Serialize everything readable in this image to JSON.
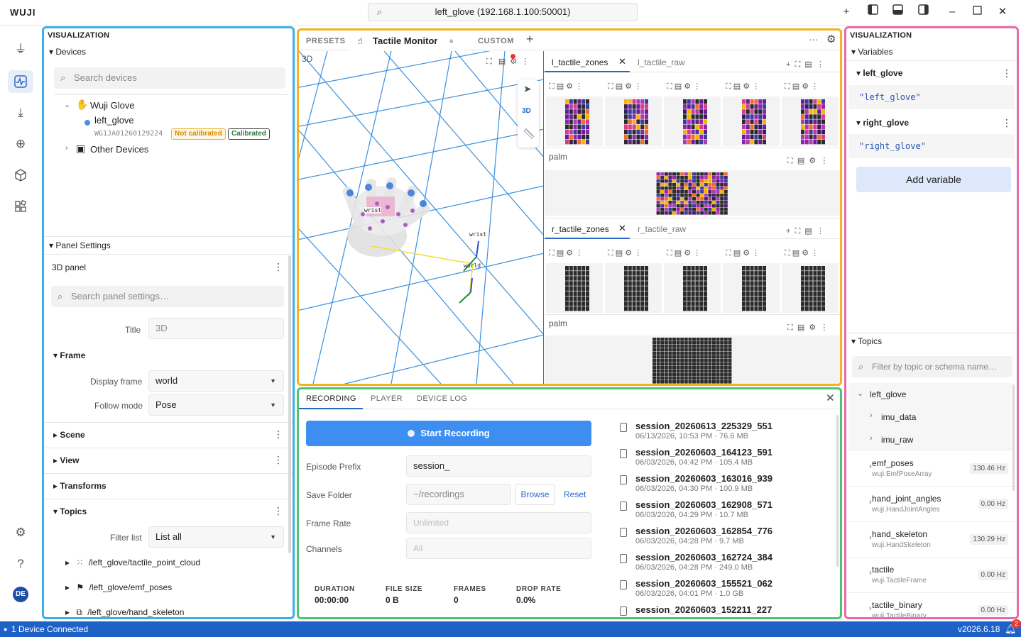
{
  "app": {
    "logo": "WUJI",
    "url": "left_glove (192.168.1.100:50001)"
  },
  "rail": {
    "avatar": "DE"
  },
  "left": {
    "header": "VISUALIZATION",
    "devices_title": "Devices",
    "search_placeholder": "Search devices",
    "device_group": "Wuji Glove",
    "device_name": "left_glove",
    "device_serial": "WG1JA01260129224",
    "badge_not_cal": "Not calibrated",
    "badge_cal": "Calibrated",
    "other_devices": "Other Devices",
    "panel_settings": "Panel Settings",
    "panel_name": "3D panel",
    "settings_search": "Search panel settings…",
    "title_label": "Title",
    "title_value": "3D",
    "frame": "Frame",
    "display_frame_label": "Display frame",
    "display_frame_value": "world",
    "follow_mode_label": "Follow mode",
    "follow_mode_value": "Pose",
    "scene": "Scene",
    "view": "View",
    "transforms": "Transforms",
    "topics": "Topics",
    "filter_label": "Filter list",
    "filter_value": "List all",
    "topic_items": [
      "/left_glove/tactile_point_cloud",
      "/left_glove/emf_poses",
      "/left_glove/hand_skeleton"
    ]
  },
  "mid": {
    "presets": "PRESETS",
    "active_tab": "Tactile Monitor",
    "custom": "CUSTOM",
    "view3d_label": "3D",
    "view3d_mode": "3D",
    "label_wrist": "wrist",
    "label_world": "world",
    "top_tabs": [
      "l_tactile_zones",
      "l_tactile_raw"
    ],
    "bottom_tabs": [
      "r_tactile_zones",
      "r_tactile_raw"
    ],
    "palm_top": "palm",
    "palm_bottom": "palm"
  },
  "rec": {
    "tabs": [
      "RECORDING",
      "PLAYER",
      "DEVICE LOG"
    ],
    "start_button": "Start Recording",
    "prefix_label": "Episode Prefix",
    "prefix_value": "session_",
    "folder_label": "Save Folder",
    "folder_value": "~/recordings",
    "browse": "Browse",
    "reset": "Reset",
    "framerate_label": "Frame Rate",
    "framerate_placeholder": "Unlimited",
    "channels_label": "Channels",
    "channels_placeholder": "All",
    "stats": [
      {
        "label": "DURATION",
        "value": "00:00:00"
      },
      {
        "label": "FILE SIZE",
        "value": "0 B"
      },
      {
        "label": "FRAMES",
        "value": "0"
      },
      {
        "label": "DROP RATE",
        "value": "0.0%"
      }
    ],
    "files": [
      {
        "name": "session_20260613_225329_551",
        "meta": "06/13/2026, 10:53 PM · 76.6 MB"
      },
      {
        "name": "session_20260603_164123_591",
        "meta": "06/03/2026, 04:42 PM · 105.4 MB"
      },
      {
        "name": "session_20260603_163016_939",
        "meta": "06/03/2026, 04:30 PM · 100.9 MB"
      },
      {
        "name": "session_20260603_162908_571",
        "meta": "06/03/2026, 04:29 PM · 10.7 MB"
      },
      {
        "name": "session_20260603_162854_776",
        "meta": "06/03/2026, 04:28 PM · 9.7 MB"
      },
      {
        "name": "session_20260603_162724_384",
        "meta": "06/03/2026, 04:28 PM · 249.0 MB"
      },
      {
        "name": "session_20260603_155521_062",
        "meta": "06/03/2026, 04:01 PM · 1.0 GB"
      },
      {
        "name": "session_20260603_152211_227",
        "meta": ""
      }
    ]
  },
  "right": {
    "header": "VISUALIZATION",
    "variables_title": "Variables",
    "var1_name": "left_glove",
    "var1_value": "\"left_glove\"",
    "var2_name": "right_glove",
    "var2_value": "\"right_glove\"",
    "add_variable": "Add variable",
    "topics_title": "Topics",
    "filter_placeholder": "Filter by topic or schema name…",
    "group": "left_glove",
    "sub1": "imu_data",
    "sub2": "imu_raw",
    "topics": [
      {
        "name": "emf_poses",
        "schema": "wuji.EmfPoseArray",
        "hz": "130.46 Hz"
      },
      {
        "name": "hand_joint_angles",
        "schema": "wuji.HandJointAngles",
        "hz": "0.00 Hz"
      },
      {
        "name": "hand_skeleton",
        "schema": "wuji.HandSkeleton",
        "hz": "130.29 Hz"
      },
      {
        "name": "tactile",
        "schema": "wuji.TactileFrame",
        "hz": "0.00 Hz"
      },
      {
        "name": "tactile_binary",
        "schema": "wuji.TactileBinary",
        "hz": "0.00 Hz"
      }
    ]
  },
  "status": {
    "left": "1 Device Connected",
    "version": "v2026.6.18",
    "notif_count": "2"
  },
  "colors": {
    "left_border": "#3ab0e8",
    "mid_border": "#f5b21b",
    "rec_border": "#4dc56d",
    "right_border": "#e86aa8",
    "primary": "#3d8ef0",
    "status": "#1f62c7"
  }
}
